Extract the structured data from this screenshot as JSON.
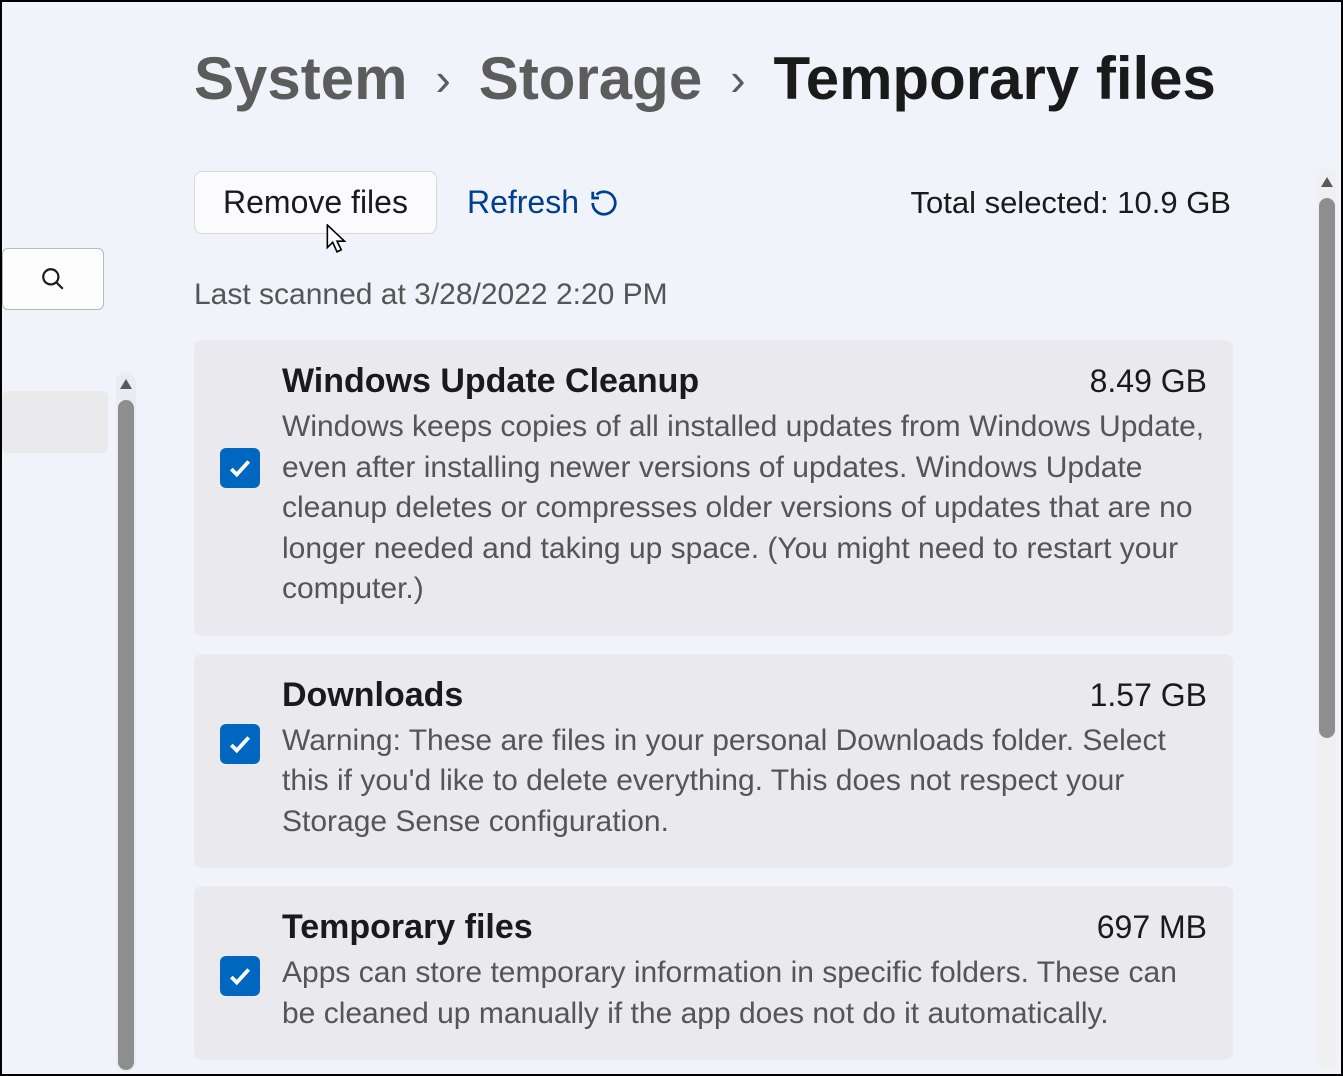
{
  "breadcrumb": {
    "root": "System",
    "mid": "Storage",
    "current": "Temporary files",
    "sep": "›"
  },
  "toolbar": {
    "remove_label": "Remove files",
    "refresh_label": "Refresh",
    "total_label": "Total selected: 10.9 GB"
  },
  "last_scanned": "Last scanned at 3/28/2022 2:20 PM",
  "items": [
    {
      "title": "Windows Update Cleanup",
      "size": "8.49 GB",
      "desc": "Windows keeps copies of all installed updates from Windows Update, even after installing newer versions of updates. Windows Update cleanup deletes or compresses older versions of updates that are no longer needed and taking up space. (You might need to restart your computer.)",
      "checked": true
    },
    {
      "title": "Downloads",
      "size": "1.57 GB",
      "desc": "Warning: These are files in your personal Downloads folder. Select this if you'd like to delete everything. This does not respect your Storage Sense configuration.",
      "checked": true
    },
    {
      "title": "Temporary files",
      "size": "697 MB",
      "desc": "Apps can store temporary information in specific folders. These can be cleaned up manually if the app does not do it automatically.",
      "checked": true
    }
  ]
}
